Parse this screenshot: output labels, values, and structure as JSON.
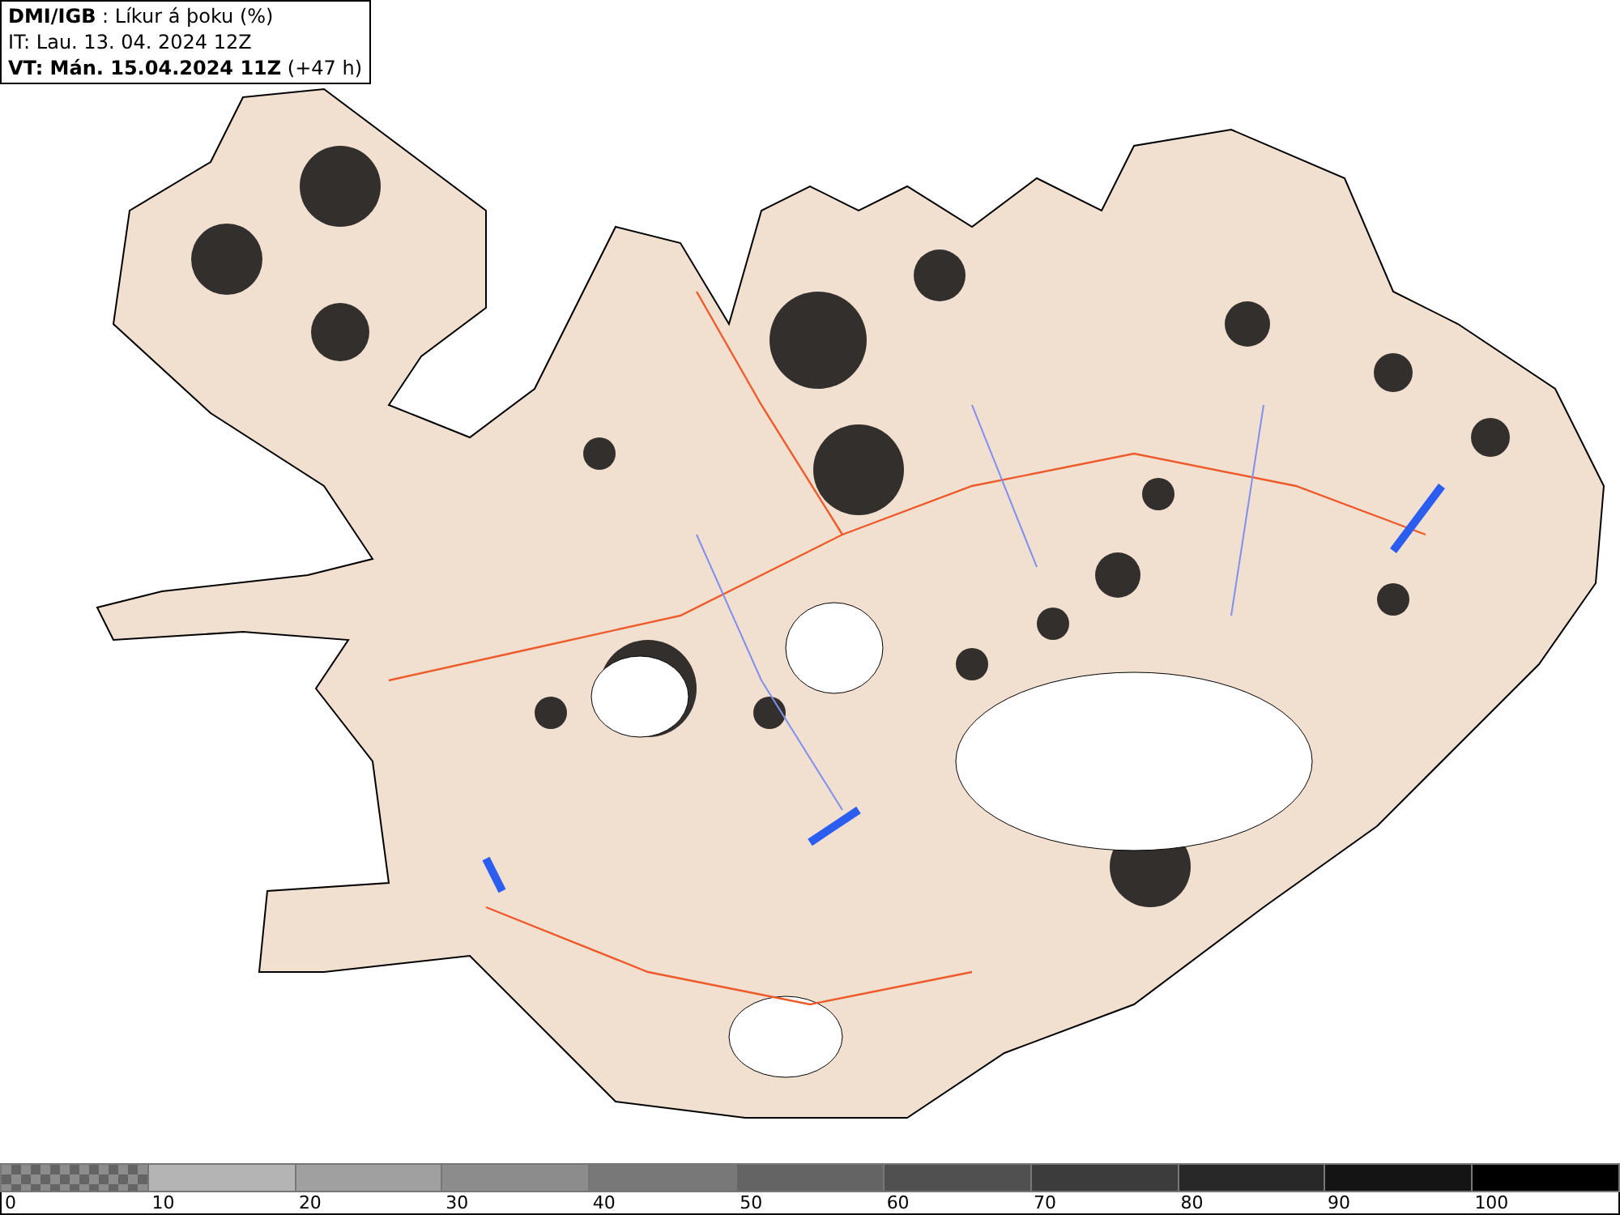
{
  "header": {
    "lines": [
      "**DMI/IGB** : Líkur á þoku (%)",
      "IT: Lau. 13. 04. 2024 12Z",
      "**VT: Mán. 15.04.2024 11Z** (+47 h)"
    ]
  },
  "legend": {
    "segments": [
      {
        "kind": "checker",
        "color": "#8c8c8c"
      },
      {
        "kind": "solid",
        "color": "#b4b4b4"
      },
      {
        "kind": "solid",
        "color": "#a0a0a0"
      },
      {
        "kind": "solid",
        "color": "#8c8c8c"
      },
      {
        "kind": "solid",
        "color": "#787878"
      },
      {
        "kind": "solid",
        "color": "#646464"
      },
      {
        "kind": "solid",
        "color": "#505050"
      },
      {
        "kind": "solid",
        "color": "#3c3c3c"
      },
      {
        "kind": "solid",
        "color": "#282828"
      },
      {
        "kind": "solid",
        "color": "#141414"
      },
      {
        "kind": "solid",
        "color": "#000000"
      }
    ],
    "labels": [
      "0",
      "10",
      "20",
      "30",
      "40",
      "50",
      "60",
      "70",
      "80",
      "90",
      "100"
    ]
  }
}
